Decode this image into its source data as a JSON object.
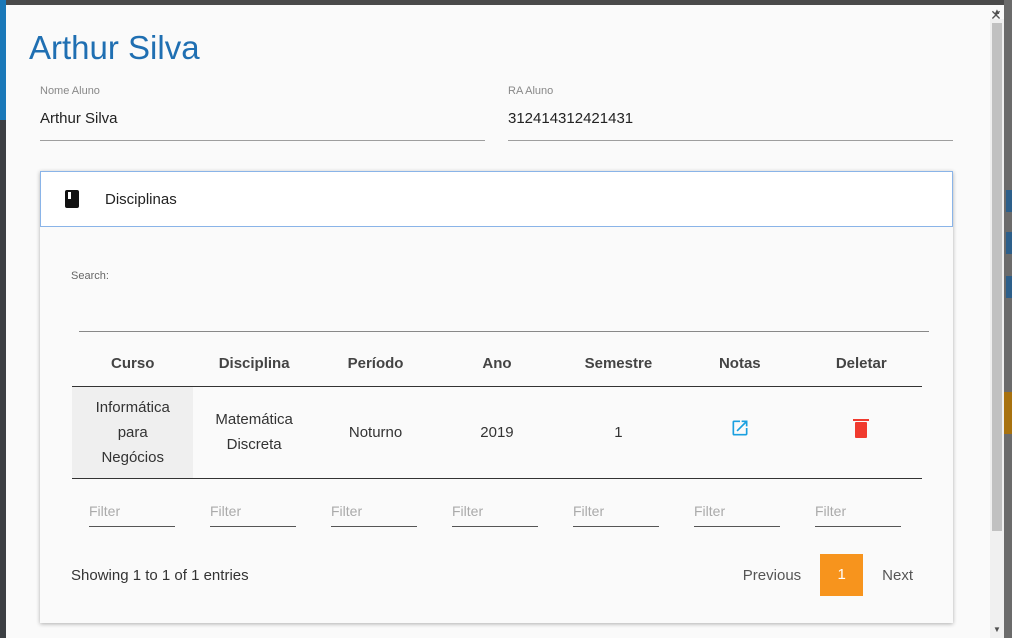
{
  "modal": {
    "title": "Arthur Silva",
    "close_icon": "close-icon"
  },
  "fields": {
    "nome_label": "Nome Aluno",
    "nome_value": "Arthur Silva",
    "ra_label": "RA Aluno",
    "ra_value": "312414312421431"
  },
  "panel": {
    "title": "Disciplinas",
    "icon": "book-icon",
    "search_label": "Search:"
  },
  "table": {
    "headers": [
      "Curso",
      "Disciplina",
      "Período",
      "Ano",
      "Semestre",
      "Notas",
      "Deletar"
    ],
    "rows": [
      {
        "curso_l1": "Informática",
        "curso_l2": "para",
        "curso_l3": "Negócios",
        "disciplina_l1": "Matemática",
        "disciplina_l2": "Discreta",
        "periodo": "Noturno",
        "ano": "2019",
        "semestre": "1",
        "notas_icon": "external-link-icon",
        "deletar_icon": "trash-icon"
      }
    ],
    "filter_placeholder": "Filter"
  },
  "footer": {
    "info": "Showing 1 to 1 of 1 entries",
    "previous": "Previous",
    "current_page": "1",
    "next": "Next"
  },
  "colors": {
    "title": "#1f6fb2",
    "accent": "#f7941d",
    "link_icon": "#1aa0e0",
    "delete_icon": "#f03a2e"
  }
}
